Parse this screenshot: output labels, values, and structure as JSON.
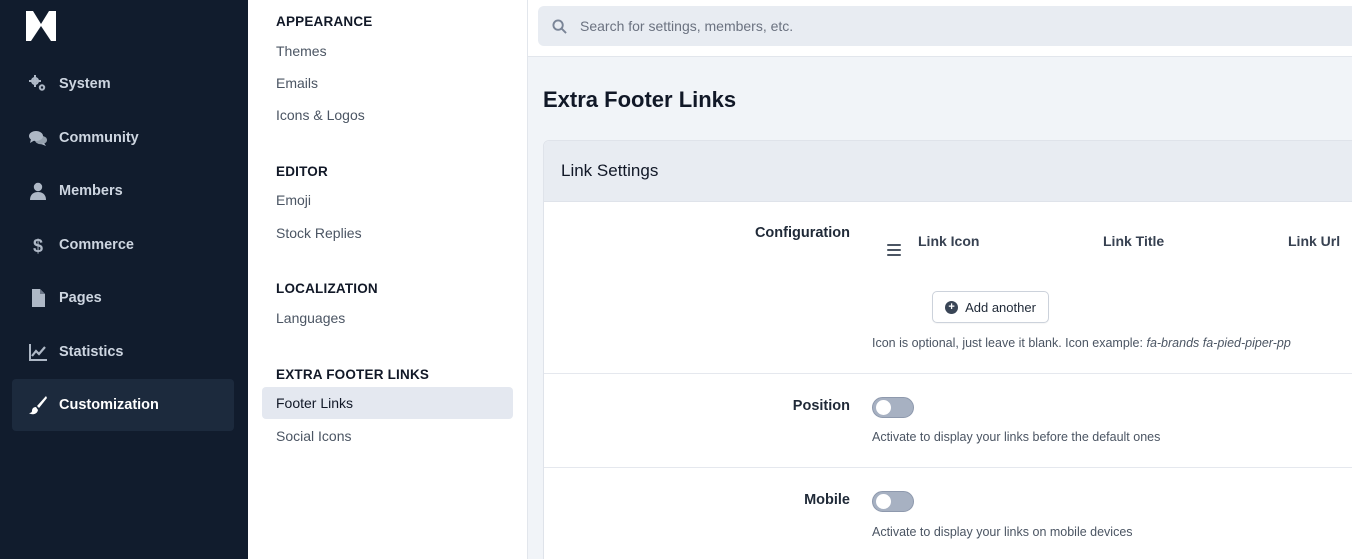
{
  "nav": {
    "items": [
      {
        "label": "System",
        "icon": "gears-icon"
      },
      {
        "label": "Community",
        "icon": "comments-icon"
      },
      {
        "label": "Members",
        "icon": "user-icon"
      },
      {
        "label": "Commerce",
        "icon": "dollar-icon"
      },
      {
        "label": "Pages",
        "icon": "file-icon"
      },
      {
        "label": "Statistics",
        "icon": "chart-line-icon"
      },
      {
        "label": "Customization",
        "icon": "paintbrush-icon",
        "active": true
      }
    ]
  },
  "subnav": {
    "sections": [
      {
        "heading": "APPEARANCE",
        "links": [
          "Themes",
          "Emails",
          "Icons & Logos"
        ]
      },
      {
        "heading": "EDITOR",
        "links": [
          "Emoji",
          "Stock Replies"
        ]
      },
      {
        "heading": "LOCALIZATION",
        "links": [
          "Languages"
        ]
      },
      {
        "heading": "EXTRA FOOTER LINKS",
        "links": [
          "Footer Links",
          "Social Icons"
        ]
      }
    ],
    "active_link": "Footer Links"
  },
  "search": {
    "placeholder": "Search for settings, members, etc."
  },
  "page": {
    "title": "Extra Footer Links"
  },
  "panel": {
    "title": "Link Settings",
    "configuration": {
      "label": "Configuration",
      "columns": [
        "Link Icon",
        "Link Title",
        "Link Url"
      ],
      "add_button": "Add another",
      "help_prefix": "Icon is optional, just leave it blank. Icon example: ",
      "help_example": "fa-brands fa-pied-piper-pp"
    },
    "position": {
      "label": "Position",
      "enabled": false,
      "help": "Activate to display your links before the default ones"
    },
    "mobile": {
      "label": "Mobile",
      "enabled": false,
      "help": "Activate to display your links on mobile devices"
    }
  },
  "colors": {
    "nav_bg": "#111c2d",
    "nav_active_bg": "#1c2a3d",
    "subnav_active_bg": "#e4e8f0",
    "toggle_off": "#a7b1c2"
  }
}
